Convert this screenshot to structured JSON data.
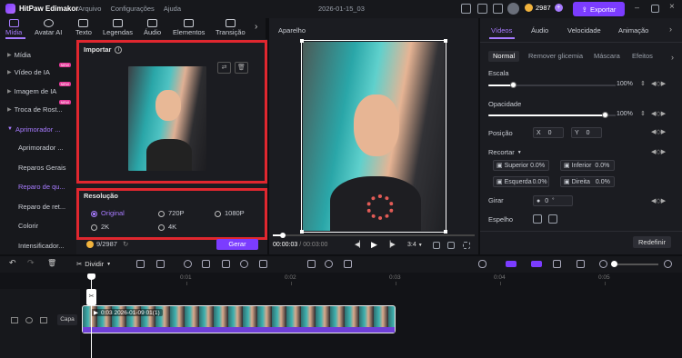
{
  "app": {
    "title": "HitPaw Edimakor",
    "menu": [
      "Arquivo",
      "Configurações",
      "Ajuda"
    ],
    "doc_title": "2026-01-15_03",
    "credits": "2987",
    "export_label": "Exportar"
  },
  "tool_tabs": [
    "Mídia",
    "Avatar AI",
    "Texto",
    "Legendas",
    "Áudio",
    "Elementos",
    "Transição"
  ],
  "left_nav": {
    "items": [
      "Mídia",
      "Vídeo de IA",
      "Imagem de IA",
      "Troca de Rost...",
      "Aprimorador ..."
    ],
    "badges": [
      "NEW",
      "NEW",
      "NEW"
    ],
    "sub_items": [
      "Aprimorador ...",
      "Reparos Gerais",
      "Reparo de qu...",
      "Reparo de ret...",
      "Colorir",
      "Intensificador..."
    ]
  },
  "import_panel": {
    "title": "Importar",
    "resolution_title": "Resolução",
    "resolution_options": [
      "Original",
      "720P",
      "1080P",
      "2K",
      "4K"
    ],
    "selected_resolution": "Original",
    "cost": "9/2987",
    "generate_label": "Gerar"
  },
  "player": {
    "title": "Aparelho",
    "current_time": "00:00:03",
    "total_time": "00:03:00",
    "aspect": "3:4"
  },
  "inspector": {
    "tabs": [
      "Vídeos",
      "Áudio",
      "Velocidade",
      "Animação"
    ],
    "sub_tabs": [
      "Normal",
      "Remover glicemia",
      "Máscara",
      "Efeitos"
    ],
    "scale_label": "Escala",
    "scale_value": "100%",
    "opacity_label": "Opacidade",
    "opacity_value": "100%",
    "position_label": "Posição",
    "pos_x_label": "X",
    "pos_x": "0",
    "pos_y_label": "Y",
    "pos_y": "0",
    "crop_label": "Recortar",
    "crop_fields": [
      {
        "label": "Superior",
        "value": "0.0%"
      },
      {
        "label": "Inferior",
        "value": "0.0%"
      },
      {
        "label": "Esquerda",
        "value": "0.0%"
      },
      {
        "label": "Direita",
        "value": "0.0%"
      }
    ],
    "rotate_label": "Girar",
    "rotate_value": "0",
    "mirror_label": "Espelho",
    "reset_label": "Redefinir"
  },
  "timeline": {
    "split_label": "Dividir",
    "ruler": [
      "0:01",
      "0:02",
      "0:03",
      "0:04",
      "0:05"
    ],
    "track_label": "Capa",
    "clip_label": "0:03 2026-01-09 01(1)"
  },
  "colors": {
    "accent": "#a77bff",
    "export_button": "#7b3cff",
    "highlight_box": "#e0272f"
  }
}
